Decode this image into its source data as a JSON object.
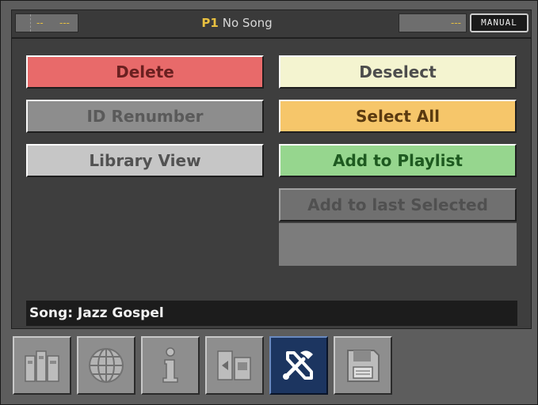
{
  "header": {
    "left_seg_a": "--",
    "left_seg_b": "---",
    "player_id": "P1",
    "song_status": "No Song",
    "right_seg": "---",
    "mode": "MANUAL"
  },
  "actions": {
    "delete": "Delete",
    "id_renumber": "ID Renumber",
    "library_view": "Library View",
    "deselect": "Deselect",
    "select_all": "Select All",
    "add_to_playlist": "Add to Playlist",
    "add_to_last_selected": "Add to last Selected"
  },
  "song_bar": {
    "text": "Song:  Jazz Gospel"
  },
  "toolbar": {
    "tools": [
      {
        "icon": "library-columns-icon"
      },
      {
        "icon": "globe-icon"
      },
      {
        "icon": "info-icon"
      },
      {
        "icon": "media-transfer-icon"
      },
      {
        "icon": "tools-icon",
        "active": true
      },
      {
        "icon": "floppy-disk-icon"
      }
    ]
  },
  "colors": {
    "delete": "#e86a6a",
    "deselect": "#f4f4d0",
    "select_all": "#f6c66a",
    "add_to_playlist": "#96d68e",
    "active_tool": "#1c3560",
    "accent": "#e8c040"
  }
}
